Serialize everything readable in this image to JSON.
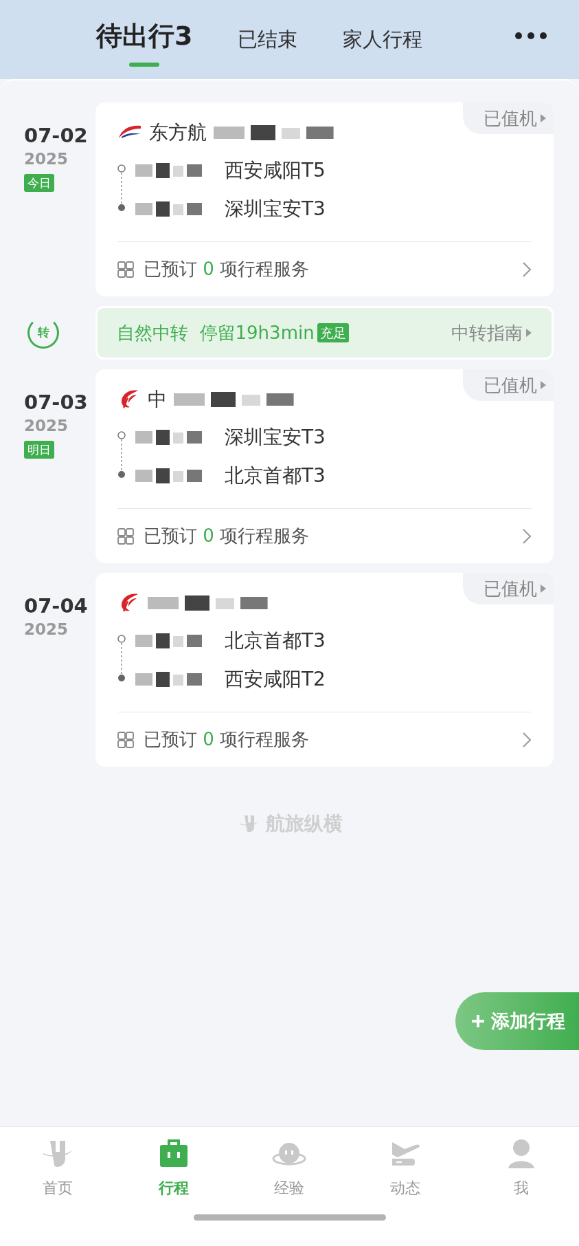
{
  "tabs": [
    {
      "label": "待出行3",
      "selected": true
    },
    {
      "label": "已结束",
      "selected": false
    },
    {
      "label": "家人行程",
      "selected": false
    }
  ],
  "timeline": [
    {
      "kind": "flight",
      "date": "07-02",
      "year": "2025",
      "day_badge": "今日",
      "logo": {
        "kind": "eastern"
      },
      "airline": "东方航",
      "status": "已值机",
      "stops": [
        {
          "airport": "西安咸阳T5"
        },
        {
          "airport": "深圳宝安T3"
        }
      ],
      "services": {
        "prefix": "已预订",
        "count": "0",
        "suffix": "项行程服务"
      }
    },
    {
      "kind": "transfer",
      "icon_label": "转",
      "text": "自然中转  停留19h3min",
      "tag": "充足",
      "link": "中转指南"
    },
    {
      "kind": "flight",
      "date": "07-03",
      "year": "2025",
      "day_badge": "明日",
      "logo": {
        "kind": "airchina"
      },
      "airline": "中",
      "status": "已值机",
      "stops": [
        {
          "airport": "深圳宝安T3"
        },
        {
          "airport": "北京首都T3"
        }
      ],
      "services": {
        "prefix": "已预订",
        "count": "0",
        "suffix": "项行程服务"
      }
    },
    {
      "kind": "flight",
      "date": "07-04",
      "year": "2025",
      "logo": {
        "kind": "airchina"
      },
      "status": "已值机",
      "stops": [
        {
          "airport": "北京首都T3"
        },
        {
          "airport": "西安咸阳T2"
        }
      ],
      "services": {
        "prefix": "已预订",
        "count": "0",
        "suffix": "项行程服务"
      }
    }
  ],
  "footer_logo": "航旅纵横",
  "add_button": "添加行程",
  "nav": [
    {
      "label": "首页",
      "kind": "home",
      "selected": false
    },
    {
      "label": "行程",
      "kind": "bag",
      "selected": true
    },
    {
      "label": "经验",
      "kind": "planet",
      "selected": false
    },
    {
      "label": "动态",
      "kind": "plane",
      "selected": false
    },
    {
      "label": "我",
      "kind": "person",
      "selected": false
    }
  ]
}
